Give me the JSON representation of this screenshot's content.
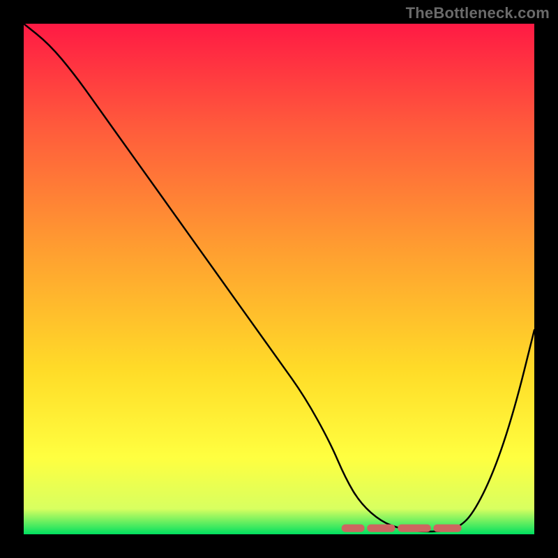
{
  "watermark": "TheBottleneck.com",
  "colors": {
    "page_bg": "#000000",
    "gradient_stops": [
      {
        "offset": "0%",
        "color": "#ff1a44"
      },
      {
        "offset": "20%",
        "color": "#ff5a3c"
      },
      {
        "offset": "45%",
        "color": "#ffa030"
      },
      {
        "offset": "68%",
        "color": "#ffdc28"
      },
      {
        "offset": "85%",
        "color": "#ffff40"
      },
      {
        "offset": "95%",
        "color": "#d8ff60"
      },
      {
        "offset": "100%",
        "color": "#00e060"
      }
    ],
    "curve": "#000000",
    "band": "#cc6660"
  },
  "chart_data": {
    "type": "line",
    "title": "",
    "xlabel": "",
    "ylabel": "",
    "xlim": [
      0,
      100
    ],
    "ylim": [
      0,
      100
    ],
    "grid": false,
    "legend": false,
    "description": "Bottleneck-percentage style curve: value descends from near 100 at x=0 to near 0 around x≈70–85 (optimal zone), then rises again toward x=100.",
    "x": [
      0,
      5,
      10,
      15,
      20,
      25,
      30,
      35,
      40,
      45,
      50,
      55,
      60,
      63,
      66,
      70,
      74,
      78,
      82,
      85,
      88,
      92,
      96,
      100
    ],
    "y": [
      100,
      96,
      90,
      83,
      76,
      69,
      62,
      55,
      48,
      41,
      34,
      27,
      18,
      11,
      6,
      2.5,
      1,
      0.5,
      0.6,
      1.2,
      4,
      12,
      24,
      40
    ],
    "optimal_band_x": [
      63,
      85
    ],
    "optimal_band_y": 1.2,
    "dash_segments_x": [
      [
        63,
        66
      ],
      [
        68,
        72
      ],
      [
        74,
        79
      ],
      [
        81,
        85
      ]
    ]
  }
}
